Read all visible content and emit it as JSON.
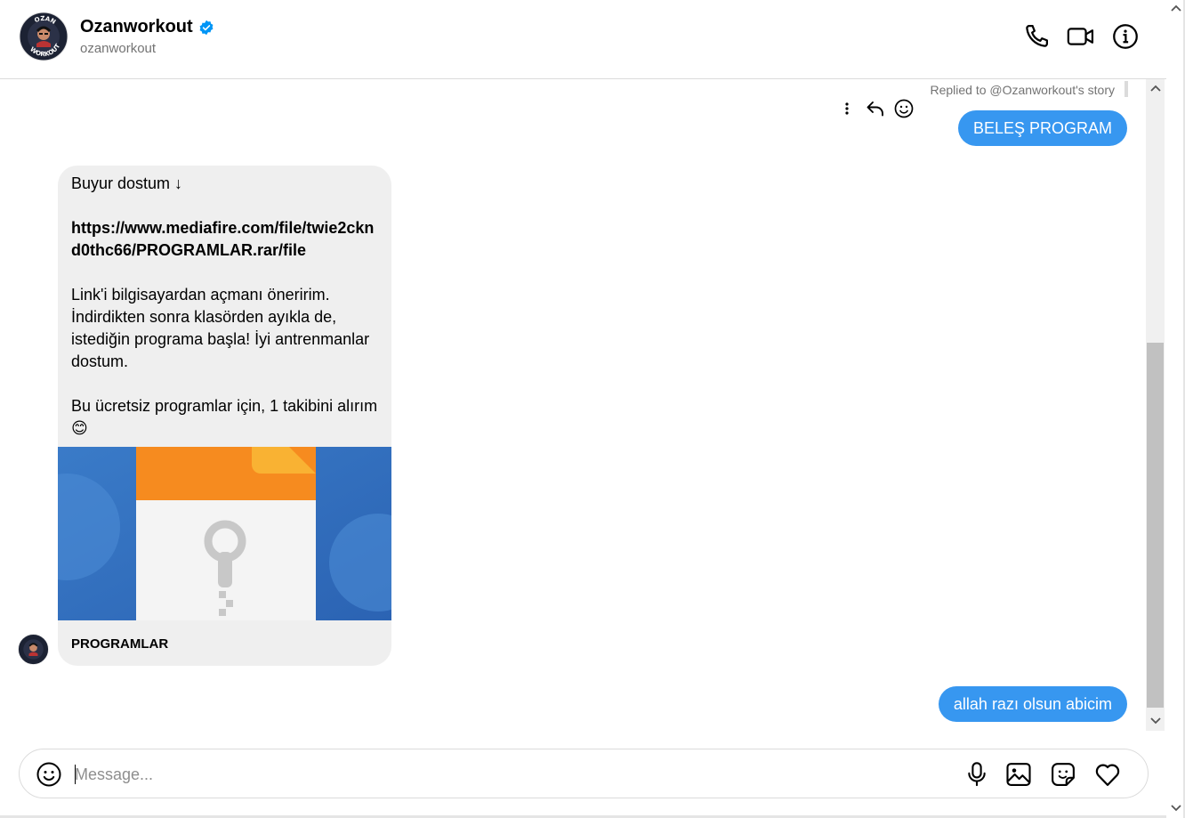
{
  "header": {
    "name": "Ozanworkout",
    "handle": "ozanworkout",
    "avatar_text_top": "OZAN",
    "avatar_text_bottom": "WORKOUT",
    "verified_icon": "verified-badge-icon",
    "call_icon": "phone-icon",
    "video_icon": "video-camera-icon",
    "info_icon": "info-icon"
  },
  "conversation": {
    "replied_label": "Replied to @Ozanworkout's story",
    "outgoing_1": "BELEŞ PROGRAM",
    "incoming": {
      "line1": "Buyur dostum ↓",
      "link": "https://www.mediafire.com/file/twie2cknd0thc66/PROGRAMLAR.rar/file",
      "paragraph2": "Link'i bilgisayardan açmanı öneririm. İndirdikten sonra klasörden ayıkla de, istediğin programa başla! İyi antrenmanlar dostum.",
      "paragraph3": "Bu ücretsiz programlar için, 1 takibini alırım 😊",
      "preview_title": "PROGRAMLAR"
    },
    "outgoing_2": "allah razı olsun abicim"
  },
  "composer": {
    "placeholder": "Message...",
    "value": ""
  },
  "colors": {
    "accent": "#3797f0",
    "incoming_bubble": "#efefef",
    "muted_text": "#737373"
  }
}
